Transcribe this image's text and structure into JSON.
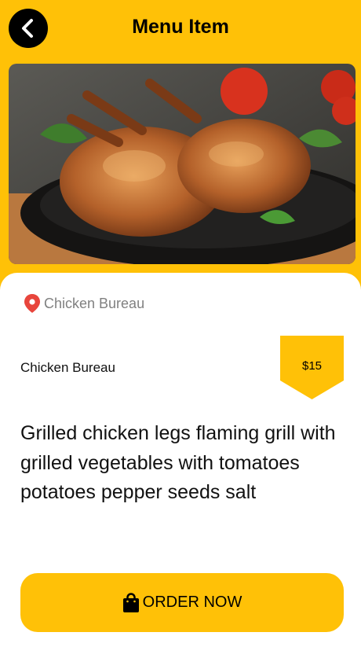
{
  "header": {
    "title": "Menu Item",
    "back_icon": "chevron-left-icon"
  },
  "item": {
    "image_alt": "Roasted quails in a cast iron pan",
    "location": "Chicken Bureau",
    "location_icon": "map-pin-icon",
    "name": "Chicken Bureau",
    "price": "$15",
    "description": "Grilled chicken legs flaming grill with grilled vegetables with tomatoes potatoes pepper seeds salt"
  },
  "order": {
    "label": "ORDER NOW",
    "icon": "shopping-bag-icon"
  },
  "colors": {
    "accent": "#ffc107",
    "pin": "#e8453c"
  }
}
